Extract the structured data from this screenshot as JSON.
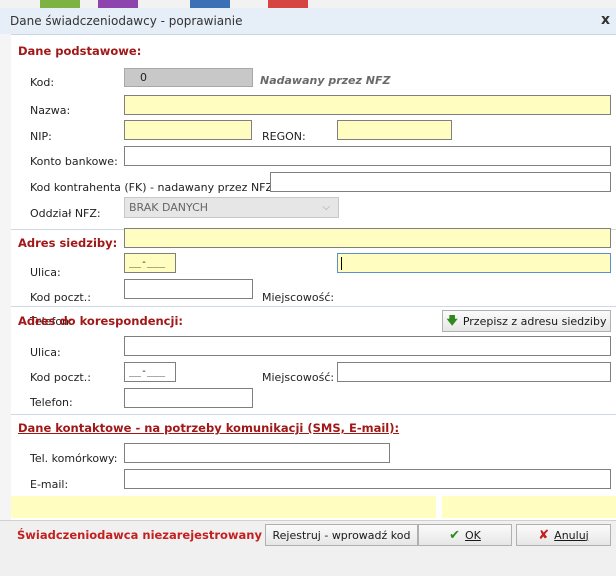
{
  "window": {
    "title": "Dane świadczeniodawcy - poprawianie",
    "close": "x"
  },
  "podstawowe": {
    "header": "Dane podstawowe:",
    "kod_label": "Kod:",
    "kod_value": "0",
    "kod_note": "Nadawany przez NFZ",
    "nazwa_label": "Nazwa:",
    "nazwa_value": "",
    "nip_label": "NIP:",
    "nip_value": "",
    "regon_label": "REGON:",
    "regon_value": "",
    "konto_label": "Konto bankowe:",
    "konto_value": "",
    "kontrahent_label": "Kod kontrahenta (FK) - nadawany przez NFZ:",
    "kontrahent_value": "",
    "oddzial_label": "Oddział NFZ:",
    "oddzial_value": "BRAK DANYCH"
  },
  "siedziba": {
    "header": "Adres siedziby:",
    "ulica_label": "Ulica:",
    "ulica_value": "",
    "kod_label": "Kod poczt.:",
    "kod_value": "__-___",
    "miejscowosc_label": "Miejscowość:",
    "miejscowosc_value": "",
    "telefon_label": "Telefon:",
    "telefon_value": ""
  },
  "korespondencja": {
    "header": "Adres do korespondencji:",
    "copy_button": "Przepisz z adresu siedziby",
    "ulica_label": "Ulica:",
    "ulica_value": "",
    "kod_label": "Kod poczt.:",
    "kod_value": "__-___",
    "miejscowosc_label": "Miejscowość:",
    "miejscowosc_value": "",
    "telefon_label": "Telefon:",
    "telefon_value": ""
  },
  "kontakt": {
    "header": "Dane kontaktowe - na potrzeby komunikacji (SMS, E-mail):",
    "tel_label": "Tel. komórkowy:",
    "tel_value": "",
    "email_label": "E-mail:",
    "email_value": ""
  },
  "footer": {
    "status": "Świadczeniodawca niezarejestrowany ->",
    "register_button": "Rejestruj - wprowadź kod",
    "ok_button": "OK",
    "cancel_button": "Anuluj"
  },
  "colors": {
    "accent_red": "#a11818",
    "required_yellow": "#fffdc0",
    "ok_green": "#2f8a1e",
    "cancel_red": "#c42020"
  }
}
